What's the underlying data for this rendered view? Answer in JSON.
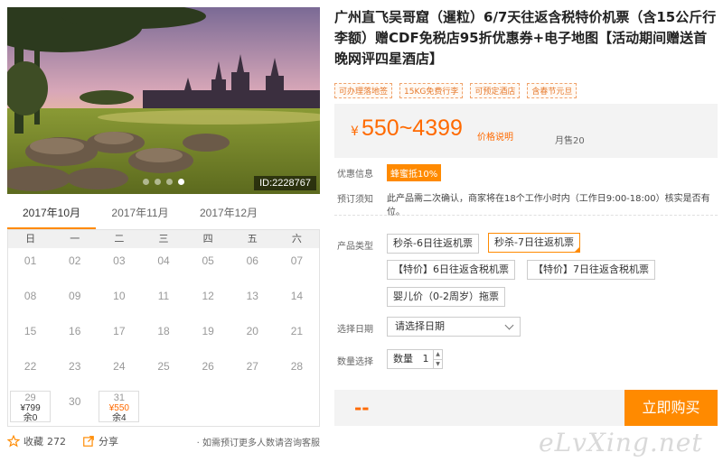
{
  "hero": {
    "id_label": "ID:2228767"
  },
  "calendar": {
    "months": [
      "2017年10月",
      "2017年11月",
      "2017年12月"
    ],
    "weekdays": [
      "日",
      "一",
      "二",
      "三",
      "四",
      "五",
      "六"
    ],
    "days": [
      [
        "01",
        "02",
        "03",
        "04",
        "05",
        "06",
        "07"
      ],
      [
        "08",
        "09",
        "10",
        "11",
        "12",
        "13",
        "14"
      ],
      [
        "15",
        "16",
        "17",
        "18",
        "19",
        "20",
        "21"
      ],
      [
        "22",
        "23",
        "24",
        "25",
        "26",
        "27",
        "28"
      ]
    ],
    "last_row": {
      "d29": {
        "day": "29",
        "price": "¥799",
        "stock": "余0"
      },
      "d30": {
        "day": "30"
      },
      "d31": {
        "day": "31",
        "price": "¥550",
        "stock": "余4"
      }
    }
  },
  "footer": {
    "fav_label": "收藏",
    "fav_count": "272",
    "share_label": "分享",
    "consult": "· 如需预订更多人数请咨询客服"
  },
  "product": {
    "title": "广州直飞吴哥窟（暹粒）6/7天往返含税特价机票（含15公斤行李额）赠CDF免税店95折优惠券+电子地图【活动期间赠送首晚网评四星酒店】",
    "tags": [
      "可办理落地签",
      "15KG免费行李",
      "可预定酒店",
      "含春节元旦"
    ],
    "price": {
      "currency": "¥",
      "value": "550~4399",
      "link": "价格说明",
      "sold": "月售20"
    },
    "promo_label": "优惠信息",
    "promo_badge": "蜂蜜抵10%",
    "notice_label": "预订须知",
    "notice_text": "此产品需二次确认，商家将在18个工作小时内（工作日9:00-18:00）核实是否有位。",
    "type_label": "产品类型",
    "options": [
      "秒杀-6日往返机票",
      "秒杀-7日往返机票",
      "【特价】6日往返含税机票",
      "【特价】7日往返含税机票",
      "婴儿价（0-2周岁）拖票"
    ],
    "date_label": "选择日期",
    "date_placeholder": "请选择日期",
    "qty_label": "数量选择",
    "qty_prefix": "数量",
    "qty_value": "1",
    "total": "--",
    "buy": "立即购买"
  },
  "watermark": "eLvXing.net",
  "colors": {
    "accent": "#ff8a00",
    "price": "#ff6a00"
  }
}
